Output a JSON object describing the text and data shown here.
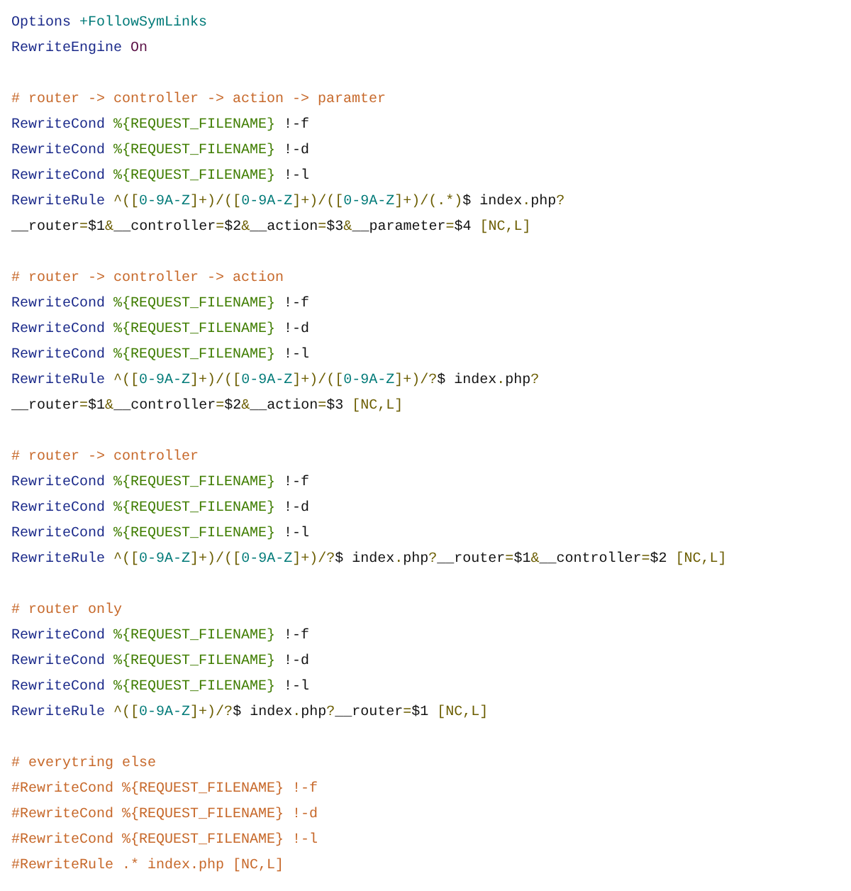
{
  "code_lines": [
    {
      "kind": "code",
      "tokens": [
        {
          "kind": "keyword",
          "text": "Options"
        },
        {
          "kind": "value",
          "text": " +FollowSymLinks"
        }
      ]
    },
    {
      "kind": "code",
      "tokens": [
        {
          "kind": "keyword",
          "text": "RewriteEngine"
        },
        {
          "kind": "constant",
          "text": " On"
        }
      ]
    },
    {
      "kind": "blank"
    },
    {
      "kind": "code",
      "tokens": [
        {
          "kind": "comment",
          "text": "# router -> controller -> action -> paramter"
        }
      ]
    },
    {
      "kind": "code",
      "tokens": [
        {
          "kind": "keyword",
          "text": "RewriteCond"
        },
        {
          "kind": "variable",
          "text": " %{REQUEST_FILENAME}"
        },
        {
          "kind": "plain",
          "text": " !-f"
        }
      ]
    },
    {
      "kind": "code",
      "tokens": [
        {
          "kind": "keyword",
          "text": "RewriteCond"
        },
        {
          "kind": "variable",
          "text": " %{REQUEST_FILENAME}"
        },
        {
          "kind": "plain",
          "text": " !-d"
        }
      ]
    },
    {
      "kind": "code",
      "tokens": [
        {
          "kind": "keyword",
          "text": "RewriteCond"
        },
        {
          "kind": "variable",
          "text": " %{REQUEST_FILENAME}"
        },
        {
          "kind": "plain",
          "text": " !-l"
        }
      ]
    },
    {
      "kind": "code",
      "tokens": [
        {
          "kind": "keyword",
          "text": "RewriteRule"
        },
        {
          "kind": "operator",
          "text": " ^(["
        },
        {
          "kind": "class",
          "text": "0-9A-Z"
        },
        {
          "kind": "operator",
          "text": "]+)/(["
        },
        {
          "kind": "class",
          "text": "0-9A-Z"
        },
        {
          "kind": "operator",
          "text": "]+)/(["
        },
        {
          "kind": "class",
          "text": "0-9A-Z"
        },
        {
          "kind": "operator",
          "text": "]+)/(.*)"
        },
        {
          "kind": "plain",
          "text": "$ index"
        },
        {
          "kind": "operator",
          "text": "."
        },
        {
          "kind": "plain",
          "text": "php"
        },
        {
          "kind": "operator",
          "text": "?"
        }
      ]
    },
    {
      "kind": "code",
      "tokens": [
        {
          "kind": "plain",
          "text": "__router"
        },
        {
          "kind": "operator",
          "text": "="
        },
        {
          "kind": "plain",
          "text": "$1"
        },
        {
          "kind": "operator",
          "text": "&"
        },
        {
          "kind": "plain",
          "text": "__controller"
        },
        {
          "kind": "operator",
          "text": "="
        },
        {
          "kind": "plain",
          "text": "$2"
        },
        {
          "kind": "operator",
          "text": "&"
        },
        {
          "kind": "plain",
          "text": "__action"
        },
        {
          "kind": "operator",
          "text": "="
        },
        {
          "kind": "plain",
          "text": "$3"
        },
        {
          "kind": "operator",
          "text": "&"
        },
        {
          "kind": "plain",
          "text": "__parameter"
        },
        {
          "kind": "operator",
          "text": "="
        },
        {
          "kind": "plain",
          "text": "$4"
        },
        {
          "kind": "operator",
          "text": " [NC,L]"
        }
      ]
    },
    {
      "kind": "blank"
    },
    {
      "kind": "code",
      "tokens": [
        {
          "kind": "comment",
          "text": "# router -> controller -> action"
        }
      ]
    },
    {
      "kind": "code",
      "tokens": [
        {
          "kind": "keyword",
          "text": "RewriteCond"
        },
        {
          "kind": "variable",
          "text": " %{REQUEST_FILENAME}"
        },
        {
          "kind": "plain",
          "text": " !-f"
        }
      ]
    },
    {
      "kind": "code",
      "tokens": [
        {
          "kind": "keyword",
          "text": "RewriteCond"
        },
        {
          "kind": "variable",
          "text": " %{REQUEST_FILENAME}"
        },
        {
          "kind": "plain",
          "text": " !-d"
        }
      ]
    },
    {
      "kind": "code",
      "tokens": [
        {
          "kind": "keyword",
          "text": "RewriteCond"
        },
        {
          "kind": "variable",
          "text": " %{REQUEST_FILENAME}"
        },
        {
          "kind": "plain",
          "text": " !-l"
        }
      ]
    },
    {
      "kind": "code",
      "tokens": [
        {
          "kind": "keyword",
          "text": "RewriteRule"
        },
        {
          "kind": "operator",
          "text": " ^(["
        },
        {
          "kind": "class",
          "text": "0-9A-Z"
        },
        {
          "kind": "operator",
          "text": "]+)/(["
        },
        {
          "kind": "class",
          "text": "0-9A-Z"
        },
        {
          "kind": "operator",
          "text": "]+)/(["
        },
        {
          "kind": "class",
          "text": "0-9A-Z"
        },
        {
          "kind": "operator",
          "text": "]+)/?"
        },
        {
          "kind": "plain",
          "text": "$ index"
        },
        {
          "kind": "operator",
          "text": "."
        },
        {
          "kind": "plain",
          "text": "php"
        },
        {
          "kind": "operator",
          "text": "?"
        }
      ]
    },
    {
      "kind": "code",
      "tokens": [
        {
          "kind": "plain",
          "text": "__router"
        },
        {
          "kind": "operator",
          "text": "="
        },
        {
          "kind": "plain",
          "text": "$1"
        },
        {
          "kind": "operator",
          "text": "&"
        },
        {
          "kind": "plain",
          "text": "__controller"
        },
        {
          "kind": "operator",
          "text": "="
        },
        {
          "kind": "plain",
          "text": "$2"
        },
        {
          "kind": "operator",
          "text": "&"
        },
        {
          "kind": "plain",
          "text": "__action"
        },
        {
          "kind": "operator",
          "text": "="
        },
        {
          "kind": "plain",
          "text": "$3"
        },
        {
          "kind": "operator",
          "text": " [NC,L]"
        }
      ]
    },
    {
      "kind": "blank"
    },
    {
      "kind": "code",
      "tokens": [
        {
          "kind": "comment",
          "text": "# router -> controller"
        }
      ]
    },
    {
      "kind": "code",
      "tokens": [
        {
          "kind": "keyword",
          "text": "RewriteCond"
        },
        {
          "kind": "variable",
          "text": " %{REQUEST_FILENAME}"
        },
        {
          "kind": "plain",
          "text": " !-f"
        }
      ]
    },
    {
      "kind": "code",
      "tokens": [
        {
          "kind": "keyword",
          "text": "RewriteCond"
        },
        {
          "kind": "variable",
          "text": " %{REQUEST_FILENAME}"
        },
        {
          "kind": "plain",
          "text": " !-d"
        }
      ]
    },
    {
      "kind": "code",
      "tokens": [
        {
          "kind": "keyword",
          "text": "RewriteCond"
        },
        {
          "kind": "variable",
          "text": " %{REQUEST_FILENAME}"
        },
        {
          "kind": "plain",
          "text": " !-l"
        }
      ]
    },
    {
      "kind": "code",
      "tokens": [
        {
          "kind": "keyword",
          "text": "RewriteRule"
        },
        {
          "kind": "operator",
          "text": " ^(["
        },
        {
          "kind": "class",
          "text": "0-9A-Z"
        },
        {
          "kind": "operator",
          "text": "]+)/(["
        },
        {
          "kind": "class",
          "text": "0-9A-Z"
        },
        {
          "kind": "operator",
          "text": "]+)/?"
        },
        {
          "kind": "plain",
          "text": "$ index"
        },
        {
          "kind": "operator",
          "text": "."
        },
        {
          "kind": "plain",
          "text": "php"
        },
        {
          "kind": "operator",
          "text": "?"
        },
        {
          "kind": "plain",
          "text": "__router"
        },
        {
          "kind": "operator",
          "text": "="
        },
        {
          "kind": "plain",
          "text": "$1"
        },
        {
          "kind": "operator",
          "text": "&"
        },
        {
          "kind": "plain",
          "text": "__controller"
        },
        {
          "kind": "operator",
          "text": "="
        },
        {
          "kind": "plain",
          "text": "$2"
        },
        {
          "kind": "operator",
          "text": " [NC,L]"
        }
      ]
    },
    {
      "kind": "blank"
    },
    {
      "kind": "code",
      "tokens": [
        {
          "kind": "comment",
          "text": "# router only"
        }
      ]
    },
    {
      "kind": "code",
      "tokens": [
        {
          "kind": "keyword",
          "text": "RewriteCond"
        },
        {
          "kind": "variable",
          "text": " %{REQUEST_FILENAME}"
        },
        {
          "kind": "plain",
          "text": " !-f"
        }
      ]
    },
    {
      "kind": "code",
      "tokens": [
        {
          "kind": "keyword",
          "text": "RewriteCond"
        },
        {
          "kind": "variable",
          "text": " %{REQUEST_FILENAME}"
        },
        {
          "kind": "plain",
          "text": " !-d"
        }
      ]
    },
    {
      "kind": "code",
      "tokens": [
        {
          "kind": "keyword",
          "text": "RewriteCond"
        },
        {
          "kind": "variable",
          "text": " %{REQUEST_FILENAME}"
        },
        {
          "kind": "plain",
          "text": " !-l"
        }
      ]
    },
    {
      "kind": "code",
      "tokens": [
        {
          "kind": "keyword",
          "text": "RewriteRule"
        },
        {
          "kind": "operator",
          "text": " ^(["
        },
        {
          "kind": "class",
          "text": "0-9A-Z"
        },
        {
          "kind": "operator",
          "text": "]+)/?"
        },
        {
          "kind": "plain",
          "text": "$ index"
        },
        {
          "kind": "operator",
          "text": "."
        },
        {
          "kind": "plain",
          "text": "php"
        },
        {
          "kind": "operator",
          "text": "?"
        },
        {
          "kind": "plain",
          "text": "__router"
        },
        {
          "kind": "operator",
          "text": "="
        },
        {
          "kind": "plain",
          "text": "$1"
        },
        {
          "kind": "operator",
          "text": " [NC,L]"
        }
      ]
    },
    {
      "kind": "blank"
    },
    {
      "kind": "code",
      "tokens": [
        {
          "kind": "comment",
          "text": "# everytring else"
        }
      ]
    },
    {
      "kind": "code",
      "tokens": [
        {
          "kind": "comment",
          "text": "#RewriteCond %{REQUEST_FILENAME} !-f"
        }
      ]
    },
    {
      "kind": "code",
      "tokens": [
        {
          "kind": "comment",
          "text": "#RewriteCond %{REQUEST_FILENAME} !-d"
        }
      ]
    },
    {
      "kind": "code",
      "tokens": [
        {
          "kind": "comment",
          "text": "#RewriteCond %{REQUEST_FILENAME} !-l"
        }
      ]
    },
    {
      "kind": "code",
      "tokens": [
        {
          "kind": "comment",
          "text": "#RewriteRule .* index.php [NC,L]"
        }
      ]
    }
  ]
}
